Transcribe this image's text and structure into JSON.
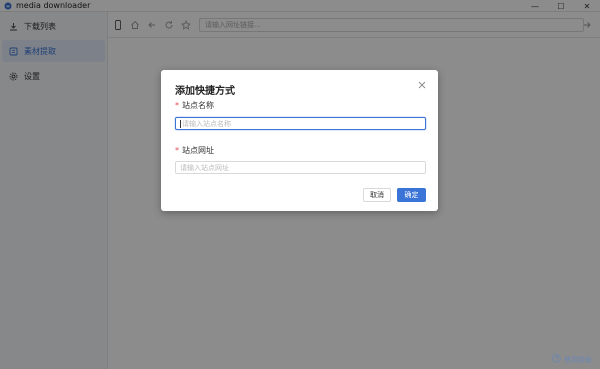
{
  "window": {
    "title": "media downloader",
    "controls": [
      "—",
      "☐",
      "✕"
    ]
  },
  "sidebar": {
    "items": [
      {
        "label": "下载列表",
        "icon": "download-icon",
        "active": false
      },
      {
        "label": "素材提取",
        "icon": "extract-icon",
        "active": true
      },
      {
        "label": "设置",
        "icon": "gear-icon",
        "active": false
      }
    ]
  },
  "toolbar": {
    "url_placeholder": "请输入网址链接..."
  },
  "dialog": {
    "title": "添加快捷方式",
    "fields": [
      {
        "label": "站点名称",
        "placeholder": "请输入站点名称",
        "required": "*"
      },
      {
        "label": "站点网址",
        "placeholder": "请输入站点网址",
        "required": "*"
      }
    ],
    "cancel_label": "取消",
    "ok_label": "确定"
  },
  "help": {
    "label": "使用帮助"
  },
  "colors": {
    "accent": "#3a74d6",
    "required": "#e5484d"
  }
}
